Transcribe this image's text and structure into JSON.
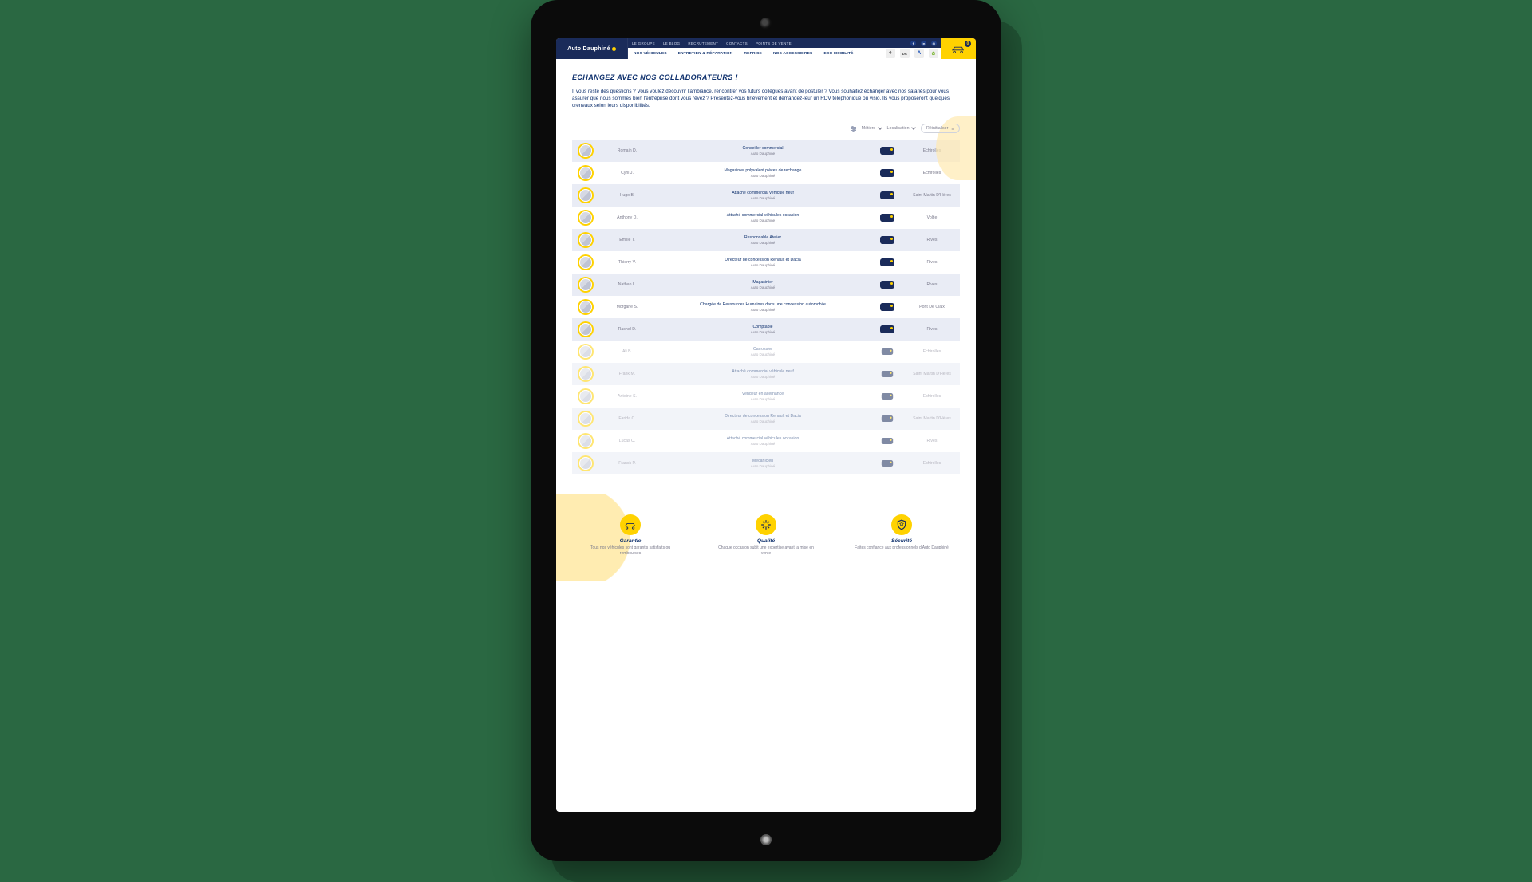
{
  "topnav": {
    "links": [
      "LE GROUPE",
      "LE BLOG",
      "RECRUTEMENT",
      "CONTACTS",
      "POINTS DE VENTE"
    ],
    "social": [
      "facebook",
      "linkedin",
      "instagram"
    ]
  },
  "brand_logo": "Auto Dauphiné",
  "mainnav": {
    "items": [
      "NOS VÉHICULES",
      "ENTRETIEN & RÉPARATION",
      "REPRISE",
      "NOS ACCESSOIRES",
      "ECO MOBILITÉ"
    ],
    "brand_badges": [
      "renault",
      "dacia",
      "alpine",
      "eco"
    ],
    "cart_count": "0"
  },
  "title": "ECHANGEZ AVEC NOS COLLABORATEURS !",
  "intro": "Il vous reste des questions ? Vous voulez découvrir l'ambiance, rencontrer vos futurs collègues avant de postuler ? Vous souhaitez échanger avec nos salariés pour vous assurer que nous sommes bien l'entreprise dont vous rêvez ? Présentez-vous brièvement et demandez-leur un RDV téléphonique ou visio. Ils vous proposeront quelques créneaux selon leurs disponibilités.",
  "filters": {
    "sort_label": "",
    "metiers": "Métiers",
    "localisation": "Localisation",
    "reset": "Réinitialiser"
  },
  "company": "Auto Dauphiné",
  "rows": [
    {
      "name": "Romain D.",
      "role": "Conseiller commercial",
      "loc": "Echirolles"
    },
    {
      "name": "Cyril J.",
      "role": "Magasinier polyvalent pièces de rechange",
      "loc": "Echirolles"
    },
    {
      "name": "Hugo B.",
      "role": "Attaché commercial véhicule neuf",
      "loc": "Saint Martin D'Hères"
    },
    {
      "name": "Anthony D.",
      "role": "Attaché commercial véhicules occasion",
      "loc": "Voltie"
    },
    {
      "name": "Emilie T.",
      "role": "Responsable Atelier",
      "loc": "Rives"
    },
    {
      "name": "Thierry V.",
      "role": "Directeur de concession Renault et Dacia",
      "loc": "Rives"
    },
    {
      "name": "Nathan L.",
      "role": "Magasinier",
      "loc": "Rives"
    },
    {
      "name": "Morgane S.",
      "role": "Chargée de Ressources Humaines dans une concession automobile",
      "loc": "Pont De Claix"
    },
    {
      "name": "Rachel D.",
      "role": "Comptable",
      "loc": "Rives"
    },
    {
      "name": "Ali B.",
      "role": "Carrossier",
      "loc": "Echirolles"
    },
    {
      "name": "Frank M.",
      "role": "Attaché commercial véhicule neuf",
      "loc": "Saint Martin D'Hères"
    },
    {
      "name": "Antoine S.",
      "role": "Vendeur en alternance",
      "loc": "Echirolles"
    },
    {
      "name": "Farida C.",
      "role": "Directeur de concession Renault et Dacia",
      "loc": "Saint Martin D'Hères"
    },
    {
      "name": "Lucas C.",
      "role": "Attaché commercial véhicules occasion",
      "loc": "Rives"
    },
    {
      "name": "Franck P.",
      "role": "Mécanicien",
      "loc": "Echirolles"
    }
  ],
  "benefits": [
    {
      "icon": "car",
      "title": "Garantie",
      "desc": "Tous nos véhicules sont garantis satisfaits ou remboursés"
    },
    {
      "icon": "spark",
      "title": "Qualité",
      "desc": "Chaque occasion subit une expertise avant la mise en vente"
    },
    {
      "icon": "shield",
      "title": "Sécurité",
      "desc": "Faites confiance aux professionnels d'Auto Dauphiné"
    }
  ]
}
